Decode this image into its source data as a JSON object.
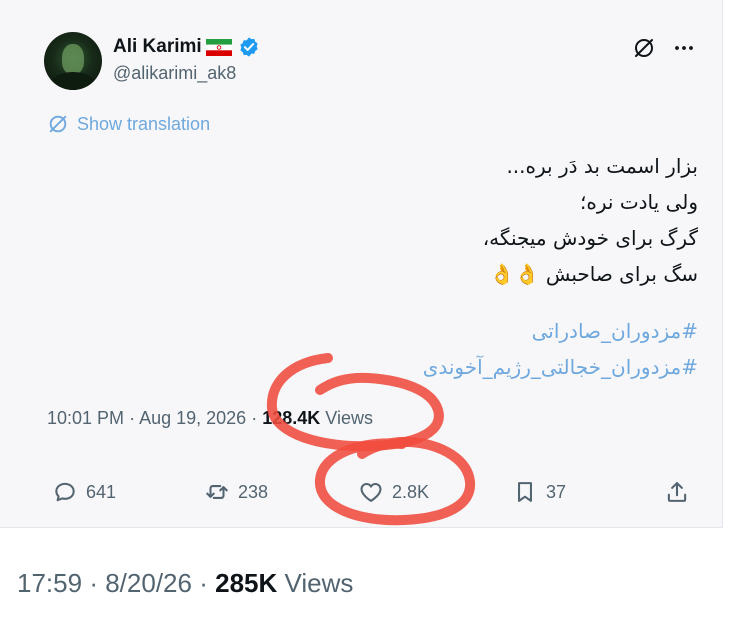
{
  "tweet": {
    "author": {
      "display_name": "Ali Karimi",
      "handle": "@alikarimi_ak8",
      "flag_icon": "iran-flag-icon",
      "verified_icon": "verified-badge-icon",
      "verified_color": "#1d9bf0"
    },
    "top_icons": {
      "grok_icon": "grok-slash-circle-icon",
      "more_icon": "more-horizontal-icon"
    },
    "translate": {
      "label": "Show translation",
      "color": "#6ea8de"
    },
    "text_lines": [
      "بزار اسمت بد دَر بره...",
      "ولی یادت نره؛",
      "گرگ برای خودش میجنگه،",
      "سگ برای صاحبش 👌👌"
    ],
    "hashtags": [
      "#مزدوران_صادراتی",
      "#مزدوران_خجالتی_رژیم_آخوندی"
    ],
    "meta": {
      "time": "10:01 PM",
      "separator": "·",
      "date": "Aug 19, 2026",
      "views_count": "128.4K",
      "views_label": "Views"
    },
    "actions": {
      "replies": "641",
      "retweets": "238",
      "likes": "2.8K",
      "bookmarks": "37"
    },
    "annotation_color": "#f04b3c"
  },
  "footer": {
    "time": "17:59",
    "separator": "·",
    "date": "8/20/26",
    "views_count": "285K",
    "views_label": "Views"
  }
}
